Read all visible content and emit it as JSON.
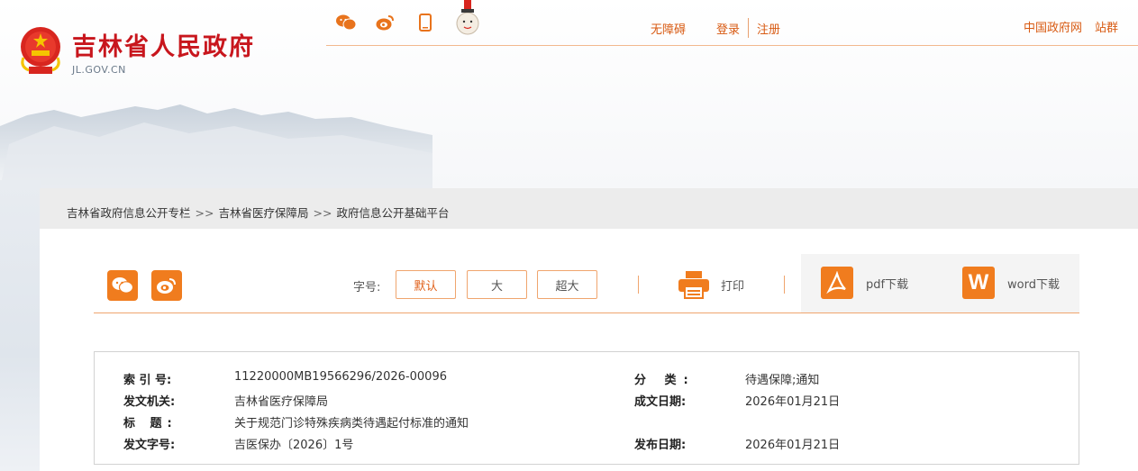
{
  "header": {
    "title": "吉林省人民政府",
    "domain": "JL.GOV.CN",
    "links": [
      "无障碍",
      "登录",
      "注册"
    ],
    "right_links": [
      "中国政府网",
      "站群"
    ],
    "social_icons": [
      "wechat-icon",
      "weibo-icon",
      "mobile-icon",
      "mascot-icon"
    ]
  },
  "breadcrumb": {
    "items": [
      "吉林省政府信息公开专栏",
      "吉林省医疗保障局",
      "政府信息公开基础平台"
    ],
    "separator": ">>"
  },
  "toolbar": {
    "font_size_label": "字号:",
    "font_sizes": [
      "默认",
      "大",
      "超大"
    ],
    "print_label": "打印",
    "pdf_label": "pdf下载",
    "word_label": "word下载",
    "word_icon_letter": "W"
  },
  "info": {
    "index_label": "索 引 号:",
    "index_value": "11220000MB19566296/2026-00096",
    "category_label": "分 类:",
    "category_value": "待遇保障;通知",
    "issuer_label": "发文机关:",
    "issuer_value": "吉林省医疗保障局",
    "created_label": "成文日期:",
    "created_value": "2026年01月21日",
    "title_label": "标 题:",
    "title_value": "关于规范门诊特殊疾病类待遇起付标准的通知",
    "doc_number_label": "发文字号:",
    "doc_number_value": "吉医保办〔2026〕1号",
    "published_label": "发布日期:",
    "published_value": "2026年01月21日"
  },
  "colors": {
    "brand_red": "#c8161d",
    "accent_orange": "#f07c1e",
    "link_orange": "#d85a12"
  }
}
